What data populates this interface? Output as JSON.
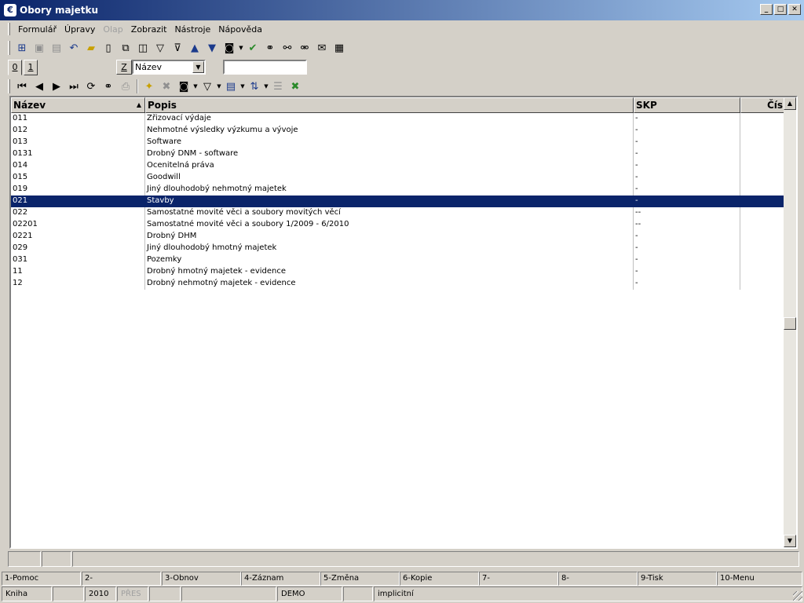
{
  "window": {
    "title": "Obory majetku",
    "icon": "app-icon",
    "minimize": "_",
    "maximize": "□",
    "close": "✕"
  },
  "menu": [
    "Formulář",
    "Úpravy",
    "Olap",
    "Zobrazit",
    "Nástroje",
    "Nápověda"
  ],
  "menu_disabled": [
    "Olap"
  ],
  "toolbar1_icons": [
    "tree-icon",
    "save-icon",
    "save-as-icon",
    "undo-icon",
    "open-icon",
    "new-icon",
    "copy-icon",
    "book-icon",
    "filter-icon",
    "filter-clear-icon",
    "up-arrow-icon",
    "down-arrow-icon",
    "snapshot-icon",
    "refresh-check-icon",
    "find-icon",
    "find-next-icon",
    "find-replace-icon",
    "mail-icon",
    "notes-icon"
  ],
  "tabs": {
    "tab0": "0",
    "tab1": "1"
  },
  "filter": {
    "z_label": "Z",
    "column_select": "Název",
    "search_value": ""
  },
  "toolbar2_icons": [
    "first-record-icon",
    "prev-record-icon",
    "next-record-icon",
    "last-record-icon",
    "refresh-icon",
    "find-icon",
    "print-icon",
    "new-record-icon",
    "delete-record-icon",
    "snapshot-icon",
    "filter-icon",
    "columns-icon",
    "sort-icon",
    "indent-icon",
    "excel-export-icon"
  ],
  "table": {
    "columns": [
      "Název",
      "Popis",
      "SKP",
      "Čís"
    ],
    "selected_row": 7,
    "rows": [
      [
        "011",
        "Zřizovací výdaje",
        "-",
        ""
      ],
      [
        "012",
        "Nehmotné výsledky výzkumu a vývoje",
        "-",
        ""
      ],
      [
        "013",
        "Software",
        "-",
        ""
      ],
      [
        "0131",
        "Drobný DNM - software",
        "-",
        ""
      ],
      [
        "014",
        "Ocenitelná práva",
        "-",
        ""
      ],
      [
        "015",
        "Goodwill",
        "-",
        ""
      ],
      [
        "019",
        "Jiný dlouhodobý nehmotný majetek",
        "-",
        ""
      ],
      [
        "021",
        "Stavby",
        "-",
        ""
      ],
      [
        "022",
        "Samostatné movité věci a soubory movitých věcí",
        "--",
        ""
      ],
      [
        "02201",
        "Samostatné movité věci a soubory  1/2009 - 6/2010",
        "--",
        ""
      ],
      [
        "0221",
        "Drobný DHM",
        "-",
        ""
      ],
      [
        "029",
        "Jiný dlouhodobý hmotný majetek",
        "-",
        ""
      ],
      [
        "031",
        "Pozemky",
        "-",
        ""
      ],
      [
        "11",
        "Drobný hmotný majetek - evidence",
        "-",
        ""
      ],
      [
        "12",
        "Drobný nehmotný majetek - evidence",
        "-",
        ""
      ]
    ]
  },
  "function_keys": [
    "1-Pomoc",
    "2-",
    "3-Obnov",
    "4-Záznam",
    "5-Změna",
    "6-Kopie",
    "7-",
    "8-",
    "9-Tisk",
    "10-Menu"
  ],
  "status": {
    "book": "Kniha",
    "empty1": "",
    "year": "2010",
    "mode": "PŘES",
    "empty2": "",
    "empty3": "",
    "db": "DEMO",
    "empty4": "",
    "profile": "implicitní"
  }
}
